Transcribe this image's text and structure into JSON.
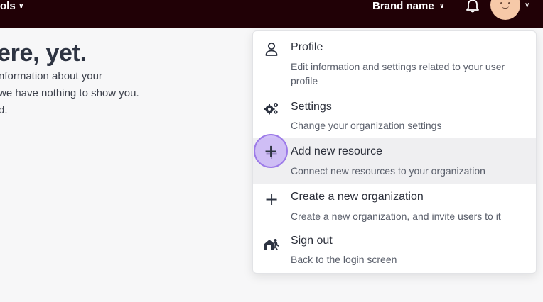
{
  "topbar": {
    "nav_left_label": "ols",
    "brand_label": "Brand name",
    "bg_color": "#210106"
  },
  "icons": {
    "nav_chevron": "chevron-down-icon",
    "brand_chevron": "chevron-down-icon",
    "notifications": "bell-icon",
    "avatar_chevron": "chevron-down-icon"
  },
  "main": {
    "headline": "ere, yet.",
    "body_lines": [
      "nformation about your",
      "we have nothing to show you.",
      "d."
    ]
  },
  "menu": {
    "items": [
      {
        "icon": "user-icon",
        "title": "Profile",
        "description": "Edit information and settings related to your user profile"
      },
      {
        "icon": "gears-icon",
        "title": "Settings",
        "description": "Change your organization settings"
      },
      {
        "icon": "plus-icon",
        "title": "Add new resource",
        "description": "Connect new resources to your organization",
        "highlighted": true
      },
      {
        "icon": "plus-icon",
        "title": "Create a new organization",
        "description": "Create a new organization, and invite users to it"
      },
      {
        "icon": "sign-out-icon",
        "title": "Sign out",
        "description": "Back to the login screen"
      }
    ]
  },
  "colors": {
    "highlight": "#efeff1",
    "pointer": "#c4adf5"
  }
}
